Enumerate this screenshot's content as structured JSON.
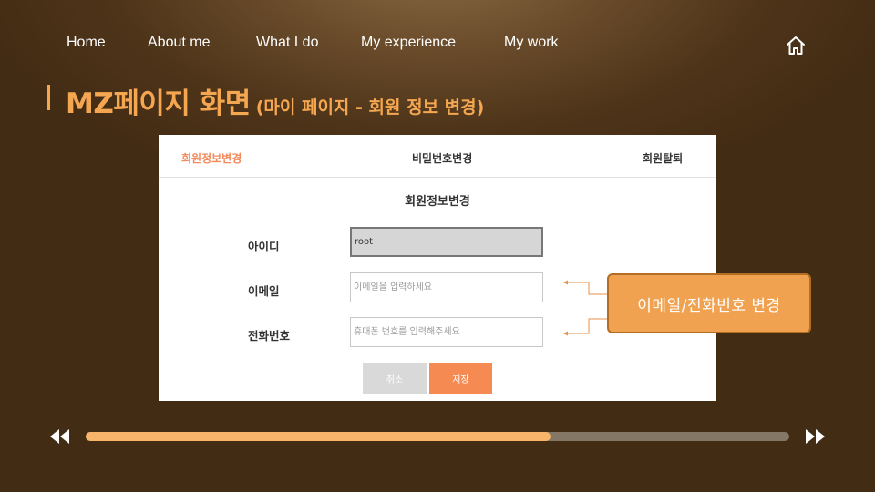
{
  "nav": {
    "items": [
      {
        "label": "Home"
      },
      {
        "label": "About me"
      },
      {
        "label": "What I do"
      },
      {
        "label": "My experience"
      },
      {
        "label": "My work"
      }
    ],
    "home_icon": "home-icon"
  },
  "title": {
    "main": "MZ페이지 화면",
    "sub": "(마이 페이지 -  회원 정보 변경)"
  },
  "screen": {
    "tabs": [
      {
        "label": "회원정보변경",
        "active": true
      },
      {
        "label": "비밀번호변경",
        "active": false
      },
      {
        "label": "회원탈퇴",
        "active": false
      }
    ],
    "form_title": "회원정보변경",
    "fields": {
      "id": {
        "label": "아이디",
        "value": "root"
      },
      "email": {
        "label": "이메일",
        "placeholder": "이메일을 입력하세요"
      },
      "phone": {
        "label": "전화번호",
        "placeholder": "휴대폰 번호를 입력해주세요"
      }
    },
    "buttons": {
      "cancel": "취소",
      "save": "저장"
    }
  },
  "callout": {
    "text": "이메일/전화번호 변경"
  },
  "player": {
    "progress": 0.66,
    "rewind_icon": "rewind-icon",
    "fast_forward_icon": "fast-forward-icon"
  },
  "colors": {
    "accent": "#f5a650",
    "active_tab": "#f08a5d",
    "save_button": "#f58a52",
    "callout_fill": "#f0a251",
    "progress_fill": "#f8b46a"
  }
}
